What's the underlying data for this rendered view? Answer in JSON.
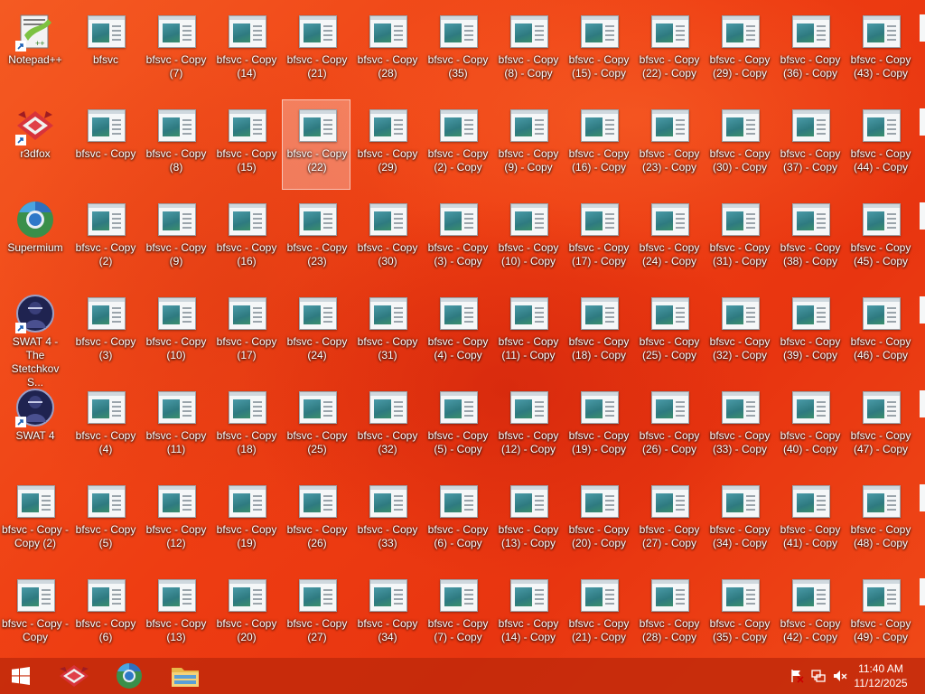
{
  "desktop": {
    "special_icons": [
      {
        "label": "Notepad++",
        "icon": "notepad-plus-plus-icon",
        "shortcut": true,
        "col": 0,
        "row": 0
      },
      {
        "label": "r3dfox",
        "icon": "r3dfox-icon",
        "shortcut": true,
        "col": 0,
        "row": 1
      },
      {
        "label": "Supermium",
        "icon": "supermium-icon",
        "shortcut": false,
        "col": 0,
        "row": 2
      },
      {
        "label": "SWAT 4 - The Stetchkov S...",
        "icon": "swat4-icon",
        "shortcut": true,
        "col": 0,
        "row": 3
      },
      {
        "label": "SWAT 4",
        "icon": "swat4-icon",
        "shortcut": true,
        "col": 0,
        "row": 4
      }
    ],
    "file_icons": [
      [
        "bfsvc",
        "bfsvc - Copy",
        "bfsvc - Copy (2)",
        "bfsvc - Copy (3)",
        "bfsvc - Copy (4)",
        "bfsvc - Copy (5)",
        "bfsvc - Copy (6)"
      ],
      [
        "bfsvc - Copy (7)",
        "bfsvc - Copy (8)",
        "bfsvc - Copy (9)",
        "bfsvc - Copy (10)",
        "bfsvc - Copy (11)",
        "bfsvc - Copy (12)",
        "bfsvc - Copy (13)"
      ],
      [
        "bfsvc - Copy (14)",
        "bfsvc - Copy (15)",
        "bfsvc - Copy (16)",
        "bfsvc - Copy (17)",
        "bfsvc - Copy (18)",
        "bfsvc - Copy (19)",
        "bfsvc - Copy (20)"
      ],
      [
        "bfsvc - Copy (21)",
        "bfsvc - Copy (22)",
        "bfsvc - Copy (23)",
        "bfsvc - Copy (24)",
        "bfsvc - Copy (25)",
        "bfsvc - Copy (26)",
        "bfsvc - Copy (27)"
      ],
      [
        "bfsvc - Copy (28)",
        "bfsvc - Copy (29)",
        "bfsvc - Copy (30)",
        "bfsvc - Copy (31)",
        "bfsvc - Copy (32)",
        "bfsvc - Copy (33)",
        "bfsvc - Copy (34)"
      ],
      [
        "bfsvc - Copy (35)",
        "bfsvc - Copy (2) - Copy",
        "bfsvc - Copy (3) - Copy",
        "bfsvc - Copy (4) - Copy",
        "bfsvc - Copy (5) - Copy",
        "bfsvc - Copy (6) - Copy",
        "bfsvc - Copy (7) - Copy"
      ],
      [
        "bfsvc - Copy (8) - Copy",
        "bfsvc - Copy (9) - Copy",
        "bfsvc - Copy (10) - Copy",
        "bfsvc - Copy (11) - Copy",
        "bfsvc - Copy (12) - Copy",
        "bfsvc - Copy (13) - Copy",
        "bfsvc - Copy (14) - Copy"
      ],
      [
        "bfsvc - Copy (15) - Copy",
        "bfsvc - Copy (16) - Copy",
        "bfsvc - Copy (17) - Copy",
        "bfsvc - Copy (18) - Copy",
        "bfsvc - Copy (19) - Copy",
        "bfsvc - Copy (20) - Copy",
        "bfsvc - Copy (21) - Copy"
      ],
      [
        "bfsvc - Copy (22) - Copy",
        "bfsvc - Copy (23) - Copy",
        "bfsvc - Copy (24) - Copy",
        "bfsvc - Copy (25) - Copy",
        "bfsvc - Copy (26) - Copy",
        "bfsvc - Copy (27) - Copy",
        "bfsvc - Copy (28) - Copy"
      ],
      [
        "bfsvc - Copy (29) - Copy",
        "bfsvc - Copy (30) - Copy",
        "bfsvc - Copy (31) - Copy",
        "bfsvc - Copy (32) - Copy",
        "bfsvc - Copy (33) - Copy",
        "bfsvc - Copy (34) - Copy",
        "bfsvc - Copy (35) - Copy"
      ],
      [
        "bfsvc - Copy (36) - Copy",
        "bfsvc - Copy (37) - Copy",
        "bfsvc - Copy (38) - Copy",
        "bfsvc - Copy (39) - Copy",
        "bfsvc - Copy (40) - Copy",
        "bfsvc - Copy (41) - Copy",
        "bfsvc - Copy (42) - Copy"
      ],
      [
        "bfsvc - Copy (43) - Copy",
        "bfsvc - Copy (44) - Copy",
        "bfsvc - Copy (45) - Copy",
        "bfsvc - Copy (46) - Copy",
        "bfsvc - Copy (47) - Copy",
        "bfsvc - Copy (48) - Copy",
        "bfsvc - Copy (49) - Copy"
      ]
    ],
    "column0_extra": [
      "bfsvc - Copy - Copy (2)",
      "bfsvc - Copy - Copy"
    ],
    "selected_label": "bfsvc - Copy (22)",
    "file_icon_name": "application-file-icon"
  },
  "taskbar": {
    "start_icon": "windows-start-icon",
    "pinned": [
      {
        "name": "r3dfox-taskbar-icon"
      },
      {
        "name": "supermium-taskbar-icon"
      },
      {
        "name": "file-explorer-taskbar-icon"
      }
    ],
    "tray": [
      {
        "name": "action-center-flag-icon"
      },
      {
        "name": "network-icon"
      },
      {
        "name": "volume-muted-icon"
      }
    ],
    "time": "11:40 AM",
    "date": "11/12/2025"
  },
  "colors": {
    "wallpaper": "#f04a18",
    "taskbar": "#be280a",
    "selection": "#ffffff"
  }
}
